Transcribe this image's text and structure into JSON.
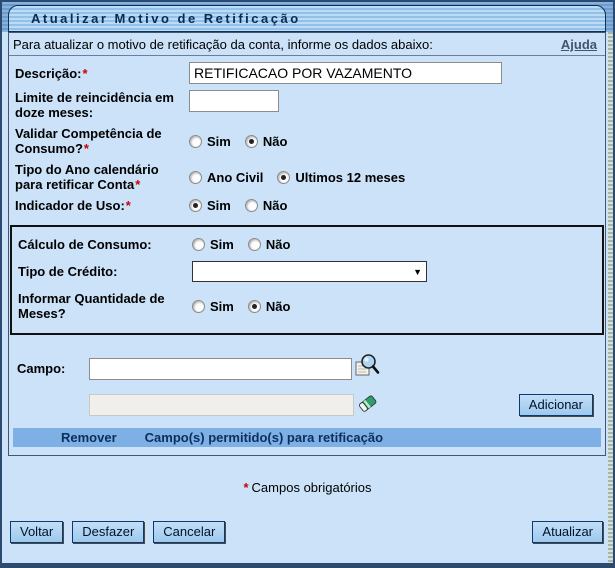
{
  "header": {
    "title": "Atualizar Motivo de Retificação"
  },
  "intro": {
    "text": "Para atualizar o motivo de retificação da conta, informe os dados abaixo:",
    "help_link": "Ajuda"
  },
  "fields": {
    "descricao": {
      "label": "Descrição:",
      "required": "*",
      "value": "RETIFICACAO POR VAZAMENTO"
    },
    "limite": {
      "label": "Limite de reincidência em doze meses:",
      "value": ""
    },
    "validar": {
      "label": "Validar Competência de Consumo?",
      "required": "*",
      "options": [
        {
          "label": "Sim",
          "checked": false
        },
        {
          "label": "Não",
          "checked": true
        }
      ]
    },
    "tipo_ano": {
      "label": "Tipo do Ano calendário para retificar Conta",
      "required": "*",
      "options": [
        {
          "label": "Ano Civil",
          "checked": false
        },
        {
          "label": "Ultimos 12 meses",
          "checked": true
        }
      ]
    },
    "indicador": {
      "label": "Indicador de Uso:",
      "required": "*",
      "options": [
        {
          "label": "Sim",
          "checked": true
        },
        {
          "label": "Não",
          "checked": false
        }
      ]
    }
  },
  "calculo_section": {
    "calculo": {
      "label": "Cálculo de Consumo:",
      "options": [
        {
          "label": "Sim",
          "checked": false
        },
        {
          "label": "Não",
          "checked": false
        }
      ]
    },
    "tipo_credito": {
      "label": "Tipo de Crédito:",
      "selected_value": ""
    },
    "informar_meses": {
      "label": "Informar Quantidade de Meses?",
      "options": [
        {
          "label": "Sim",
          "checked": false
        },
        {
          "label": "Não",
          "checked": true
        }
      ]
    }
  },
  "campo_section": {
    "label": "Campo:",
    "campo_value": "",
    "campo_description_value": "",
    "add_button": "Adicionar",
    "table": {
      "columns": [
        "Remover",
        "Campo(s) permitido(s) para retificação"
      ],
      "rows": []
    }
  },
  "icons": {
    "search": "search-icon",
    "eraser": "eraser-icon",
    "dropdown_arrow": "▼"
  },
  "footer": {
    "required_note": {
      "asterisk": "*",
      "text": "Campos obrigatórios"
    },
    "buttons": {
      "voltar": "Voltar",
      "desfazer": "Desfazer",
      "cancelar": "Cancelar",
      "atualizar": "Atualizar"
    }
  },
  "colors": {
    "page_bg": "#cbe2f8",
    "frame": "#2c4a70",
    "table_header_bg": "#7fb0e5",
    "button_bg": "#aad2f2",
    "required_red": "#cc0000",
    "title_text": "#0a2a52"
  }
}
